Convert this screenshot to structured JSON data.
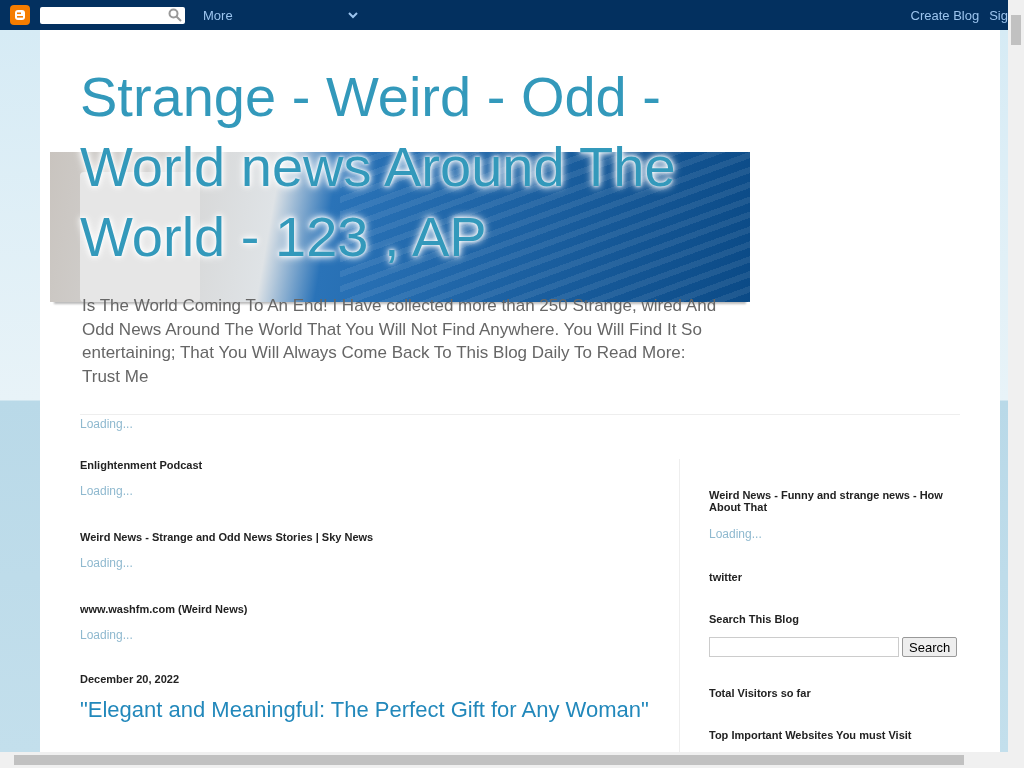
{
  "navbar": {
    "more_label": "More",
    "links": [
      "Create Blog",
      "Sig"
    ]
  },
  "header": {
    "title": "Strange - Weird - Odd - World news Around The World - 123 , AP",
    "description": "Is The World Coming To An End! I Have collected more than 250 Strange, wired And Odd News Around The World That You Will Not Find Anywhere. You Will Find It So entertaining; That You Will Always Come Back To This Blog Daily To Read More: Trust Me",
    "loading": "Loading..."
  },
  "main": {
    "widgets": [
      {
        "title": "Enlightenment Podcast",
        "loading": "Loading..."
      },
      {
        "title": "Weird News - Strange and Odd News Stories | Sky News",
        "loading": "Loading..."
      },
      {
        "title": "www.washfm.com (Weird News)",
        "loading": "Loading..."
      }
    ],
    "date": "December 20, 2022",
    "post_title": "\"Elegant and Meaningful: The Perfect Gift for Any Woman\""
  },
  "sidebar": {
    "widgets": [
      {
        "kind": "feed",
        "title": "Weird News - Funny and strange news - How About That",
        "loading": "Loading..."
      },
      {
        "kind": "plain",
        "title": "twitter"
      },
      {
        "kind": "search",
        "title": "Search This Blog",
        "button": "Search"
      },
      {
        "kind": "plain",
        "title": "Total Visitors so far"
      },
      {
        "kind": "plain",
        "title": "Top Important Websites You must Visit"
      }
    ]
  }
}
